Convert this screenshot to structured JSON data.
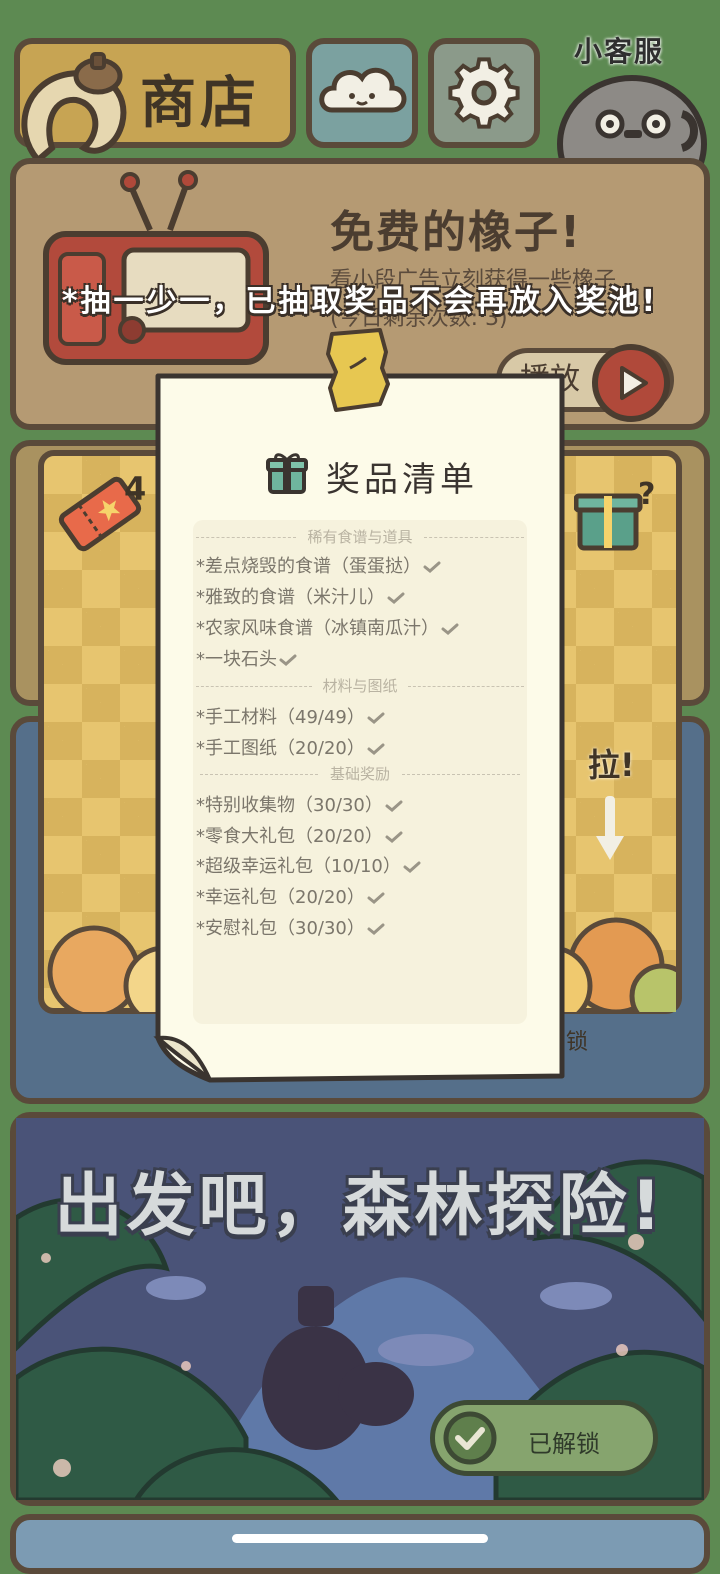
{
  "topbar": {
    "shop_label": "商店",
    "support_label": "小客服"
  },
  "free_acorns": {
    "title": "免费的橡子!",
    "desc": "看小段广告立刻获得一些橡子",
    "remaining": "(今日剩余次数: 3)",
    "play_label": "播放"
  },
  "gacha": {
    "ticket_count": "4",
    "pull_label": "拉!",
    "locked_hint": "锁",
    "notice": "*抽一少一，已抽取奖品不会再放入奖池!"
  },
  "prize_list": {
    "title": "奖品清单",
    "sections": [
      {
        "heading": "稀有食谱与道具",
        "items": [
          "*差点烧毁的食谱（蛋蛋挞）",
          "*雅致的食谱（米汁儿）",
          "*农家风味食谱（冰镇南瓜汁）",
          "*一块石头"
        ]
      },
      {
        "heading": "材料与图纸",
        "items": [
          "*手工材料（49/49）",
          "*手工图纸（20/20）"
        ]
      },
      {
        "heading": "基础奖励",
        "items": [
          "*特别收集物（30/30）",
          "*零食大礼包（20/20）",
          "*超级幸运礼包（10/10）",
          "*幸运礼包（20/20）",
          "*安慰礼包（30/30）"
        ]
      }
    ]
  },
  "forest": {
    "title": "出发吧，森林探险!",
    "unlock_label": "已解锁"
  },
  "colors": {
    "background": "#5d8a52",
    "panel_border": "#5a4a3a",
    "sheet": "#fdfbe9",
    "tape": "#e7c751"
  }
}
